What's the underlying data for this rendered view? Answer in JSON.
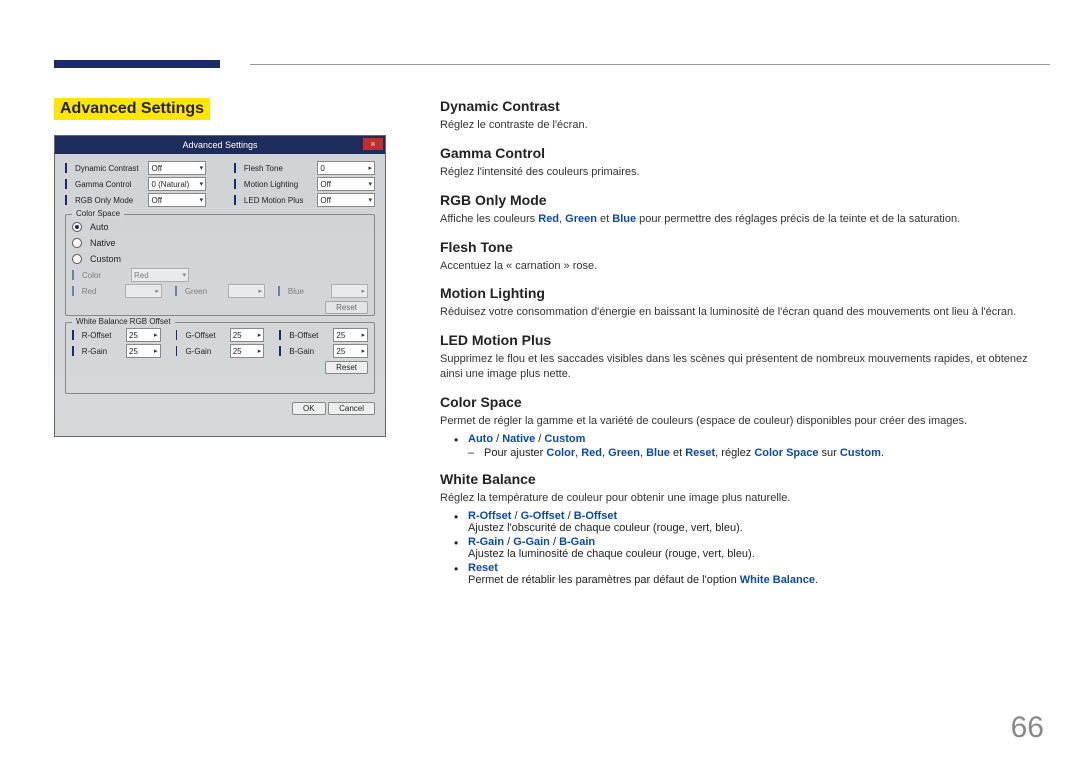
{
  "page_number": "66",
  "section_title": "Advanced Settings",
  "screenshot": {
    "title": "Advanced Settings",
    "row1": [
      {
        "label": "Dynamic Contrast",
        "value": "Off"
      },
      {
        "label": "Flesh Tone",
        "value": "0"
      }
    ],
    "row2": [
      {
        "label": "Gamma Control",
        "value": "0 (Natural)"
      },
      {
        "label": "Motion Lighting",
        "value": "Off"
      }
    ],
    "row3": [
      {
        "label": "RGB Only Mode",
        "value": "Off"
      },
      {
        "label": "LED Motion Plus",
        "value": "Off"
      }
    ],
    "color_space": {
      "title": "Color Space",
      "auto": "Auto",
      "native": "Native",
      "custom": "Custom",
      "color_label": "Color",
      "color_value": "Red",
      "rgb": [
        {
          "label": "Red",
          "value": ""
        },
        {
          "label": "Green",
          "value": ""
        },
        {
          "label": "Blue",
          "value": ""
        }
      ],
      "reset": "Reset"
    },
    "wb": {
      "title": "White Balance RGB Offset",
      "row1": [
        {
          "label": "R-Offset",
          "value": "25"
        },
        {
          "label": "G-Offset",
          "value": "25"
        },
        {
          "label": "B-Offset",
          "value": "25"
        }
      ],
      "row2": [
        {
          "label": "R-Gain",
          "value": "25"
        },
        {
          "label": "G-Gain",
          "value": "25"
        },
        {
          "label": "B-Gain",
          "value": "25"
        }
      ],
      "reset": "Reset"
    },
    "ok": "OK",
    "cancel": "Cancel"
  },
  "sections": {
    "dynamic_contrast": {
      "title": "Dynamic Contrast",
      "desc": "Réglez le contraste de l'écran."
    },
    "gamma_control": {
      "title": "Gamma Control",
      "desc": "Réglez l'intensité des couleurs primaires."
    },
    "rgb_only_mode": {
      "title": "RGB Only Mode",
      "desc_prefix": "Affiche les couleurs ",
      "red": "Red",
      "green": "Green",
      "blue": "Blue",
      "desc_suffix": " pour permettre des réglages précis de la teinte et de la saturation.",
      "comma": ", ",
      "et": " et "
    },
    "flesh_tone": {
      "title": "Flesh Tone",
      "desc": "Accentuez la « carnation » rose."
    },
    "motion_lighting": {
      "title": "Motion Lighting",
      "desc": "Réduisez votre consommation d'énergie en baissant la luminosité de l'écran quand des mouvements ont lieu à l'écran."
    },
    "led_motion_plus": {
      "title": "LED Motion Plus",
      "desc": "Supprimez le flou et les saccades visibles dans les scènes qui présentent de nombreux mouvements rapides, et obtenez ainsi une image plus nette."
    },
    "color_space": {
      "title": "Color Space",
      "desc": "Permet de régler la gamme et la variété de couleurs (espace de couleur) disponibles pour créer des images.",
      "bullet_options": {
        "auto": "Auto",
        "native": "Native",
        "custom": "Custom",
        "sep": " / "
      },
      "adjust_line": {
        "prefix": "Pour ajuster ",
        "color": "Color",
        "red": "Red",
        "green": "Green",
        "blue": "Blue",
        "reset": "Reset",
        "color_space": "Color Space",
        "custom": "Custom",
        "comma": ", ",
        "et": " et ",
        "reglez": ", réglez ",
        "sur": " sur ",
        "period": "."
      }
    },
    "white_balance": {
      "title": "White Balance",
      "desc": "Réglez la température de couleur pour obtenir une image plus naturelle.",
      "offset": {
        "r": "R-Offset",
        "g": "G-Offset",
        "b": "B-Offset",
        "sep": " / ",
        "desc": "Ajustez l'obscurité de chaque couleur (rouge, vert, bleu)."
      },
      "gain": {
        "r": "R-Gain",
        "g": "G-Gain",
        "b": "B-Gain",
        "sep": " / ",
        "desc": "Ajustez la luminosité de chaque couleur (rouge, vert, bleu)."
      },
      "reset": {
        "label": "Reset",
        "desc_prefix": "Permet de rétablir les paramètres par défaut de l'option ",
        "wb": "White Balance",
        "desc_suffix": "."
      }
    }
  }
}
